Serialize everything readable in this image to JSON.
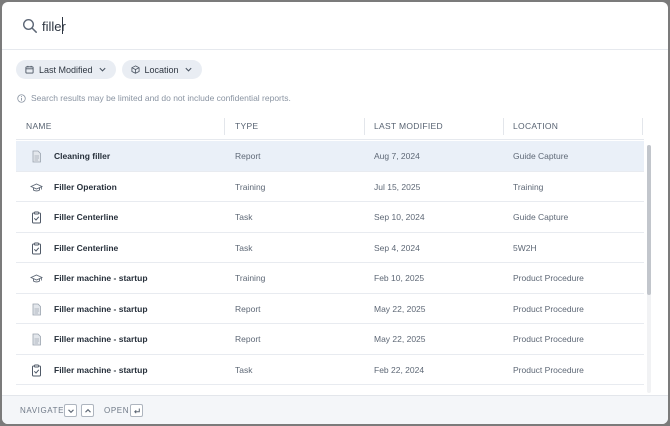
{
  "search": {
    "value": "filler",
    "placeholder": ""
  },
  "filters": [
    {
      "label": "Last Modified",
      "icon": "calendar-icon"
    },
    {
      "label": "Location",
      "icon": "box-icon"
    }
  ],
  "notice": "Search results may be limited and do not include confidential reports.",
  "columns": [
    "NAME",
    "TYPE",
    "LAST MODIFIED",
    "LOCATION"
  ],
  "rows": [
    {
      "icon": "document-icon",
      "name": "Cleaning filler",
      "type": "Report",
      "modified": "Aug 7, 2024",
      "location": "Guide Capture",
      "selected": true
    },
    {
      "icon": "graduation-cap-icon",
      "name": "Filler Operation",
      "type": "Training",
      "modified": "Jul 15, 2025",
      "location": "Training"
    },
    {
      "icon": "clipboard-check-icon",
      "name": "Filler Centerline",
      "type": "Task",
      "modified": "Sep 10, 2024",
      "location": "Guide Capture"
    },
    {
      "icon": "clipboard-check-icon",
      "name": "Filler Centerline",
      "type": "Task",
      "modified": "Sep 4, 2024",
      "location": "5W2H"
    },
    {
      "icon": "graduation-cap-icon",
      "name": "Filler machine - startup",
      "type": "Training",
      "modified": "Feb 10, 2025",
      "location": "Product Procedure"
    },
    {
      "icon": "document-icon",
      "name": "Filler machine - startup",
      "type": "Report",
      "modified": "May 22, 2025",
      "location": "Product Procedure"
    },
    {
      "icon": "document-icon",
      "name": "Filler machine - startup",
      "type": "Report",
      "modified": "May 22, 2025",
      "location": "Product Procedure"
    },
    {
      "icon": "clipboard-check-icon",
      "name": "Filler machine - startup",
      "type": "Task",
      "modified": "Feb 22, 2024",
      "location": "Product Procedure"
    },
    {
      "icon": "document-icon",
      "name": "",
      "type": "",
      "modified": "",
      "location": ""
    }
  ],
  "footer": {
    "navigate_label": "NAVIGATE",
    "open_label": "OPEN"
  },
  "colors": {
    "selected_row": "#eaf0f8",
    "chip_bg": "#e9edf3",
    "footer_bg": "#f4f6f9"
  }
}
